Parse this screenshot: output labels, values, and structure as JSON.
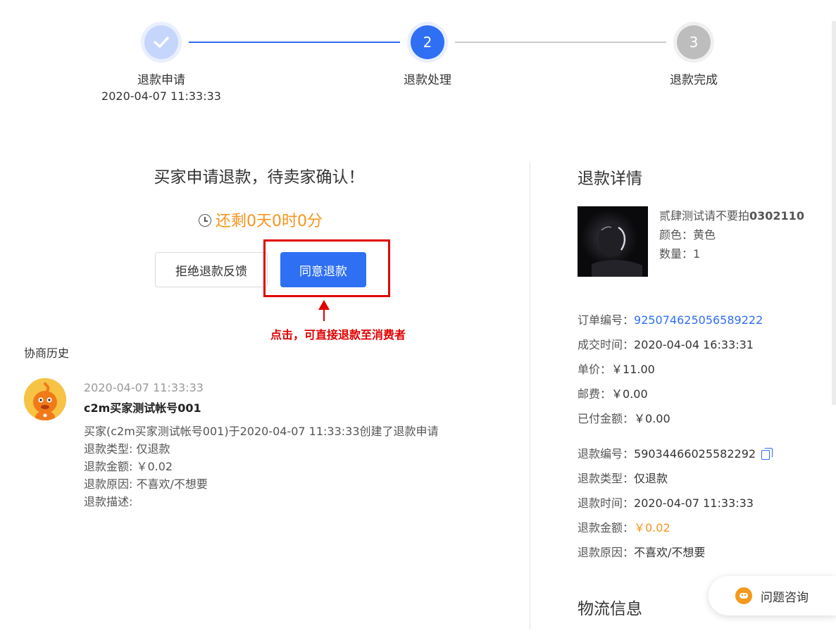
{
  "stepper": {
    "steps": [
      {
        "number": "",
        "label": "退款申请",
        "time": "2020-04-07 11:33:33",
        "state": "done"
      },
      {
        "number": "2",
        "label": "退款处理",
        "state": "active"
      },
      {
        "number": "3",
        "label": "退款完成",
        "state": "pending"
      }
    ]
  },
  "status": {
    "title": "买家申请退款，待卖家确认！",
    "countdown": "还剩0天0时0分"
  },
  "actions": {
    "reject_label": "拒绝退款反馈",
    "agree_label": "同意退款"
  },
  "annotation": {
    "text": "点击，可直接退款至消费者"
  },
  "history": {
    "title": "协商历史",
    "entries": [
      {
        "time": "2020-04-07 11:33:33",
        "user": "c2m买家测试帐号001",
        "lines": [
          "买家(c2m买家测试帐号001)于2020-04-07 11:33:33创建了退款申请",
          "退款类型: 仅退款",
          "退款金额: ￥0.02",
          "退款原因: 不喜欢/不想要",
          "退款描述:"
        ]
      }
    ]
  },
  "detail": {
    "title": "退款详情",
    "product": {
      "name_prefix": "贰肆测试请不要拍",
      "name_code": "0302110",
      "color": "颜色：黄色",
      "quantity": "数量：1"
    },
    "order_info": [
      {
        "label": "订单编号：",
        "value": "925074625056589222",
        "style": "link"
      },
      {
        "label": "成交时间：",
        "value": "2020-04-04 16:33:31",
        "style": "normal"
      },
      {
        "label": "单价：",
        "value": "￥11.00",
        "style": "normal"
      },
      {
        "label": "邮费：",
        "value": "￥0.00",
        "style": "normal"
      },
      {
        "label": "已付金额：",
        "value": "￥0.00",
        "style": "normal"
      }
    ],
    "refund_info": [
      {
        "label": "退款编号：",
        "value": "590344660255822​92",
        "style": "normal"
      },
      {
        "label": "退款类型：",
        "value": "仅退款",
        "style": "normal"
      },
      {
        "label": "退款时间：",
        "value": "2020-04-07 11:33:33",
        "style": "normal"
      },
      {
        "label": "退款金额：",
        "value": "￥0.02",
        "style": "orange"
      },
      {
        "label": "退款原因：",
        "value": "不喜欢/不想要",
        "style": "normal"
      }
    ],
    "logistics_title": "物流信息"
  },
  "consult": {
    "label": "问题咨询"
  },
  "colors": {
    "primary": "#2f6ff3",
    "orange": "#f7941d",
    "annotation_red": "#e10000",
    "step_done": "#c5d5fb",
    "step_pending": "#bdbdbd"
  }
}
